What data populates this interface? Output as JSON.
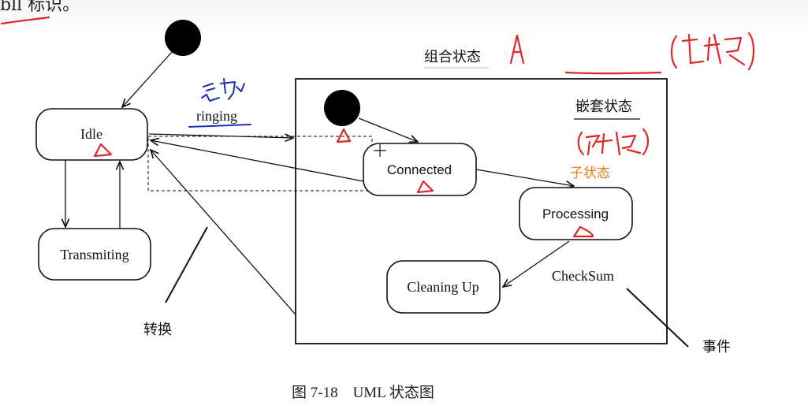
{
  "top_text": "bll 标识。",
  "states": {
    "idle": "Idle",
    "transmiting": "Transmiting",
    "connected": "Connected",
    "processing": "Processing",
    "cleaning_up": "Cleaning Up"
  },
  "transition_label": "ringing",
  "event_label": "CheckSum",
  "annotations": {
    "composite_state": "组合状态",
    "nested_state": "嵌套状态",
    "substate": "子状态",
    "transition": "转换",
    "event": "事件"
  },
  "caption": "图 7-18　UML 状态图",
  "colors": {
    "handwriting_red": "#e0262b",
    "handwriting_blue": "#1e2fb8",
    "substate_label": "#f07a12"
  }
}
